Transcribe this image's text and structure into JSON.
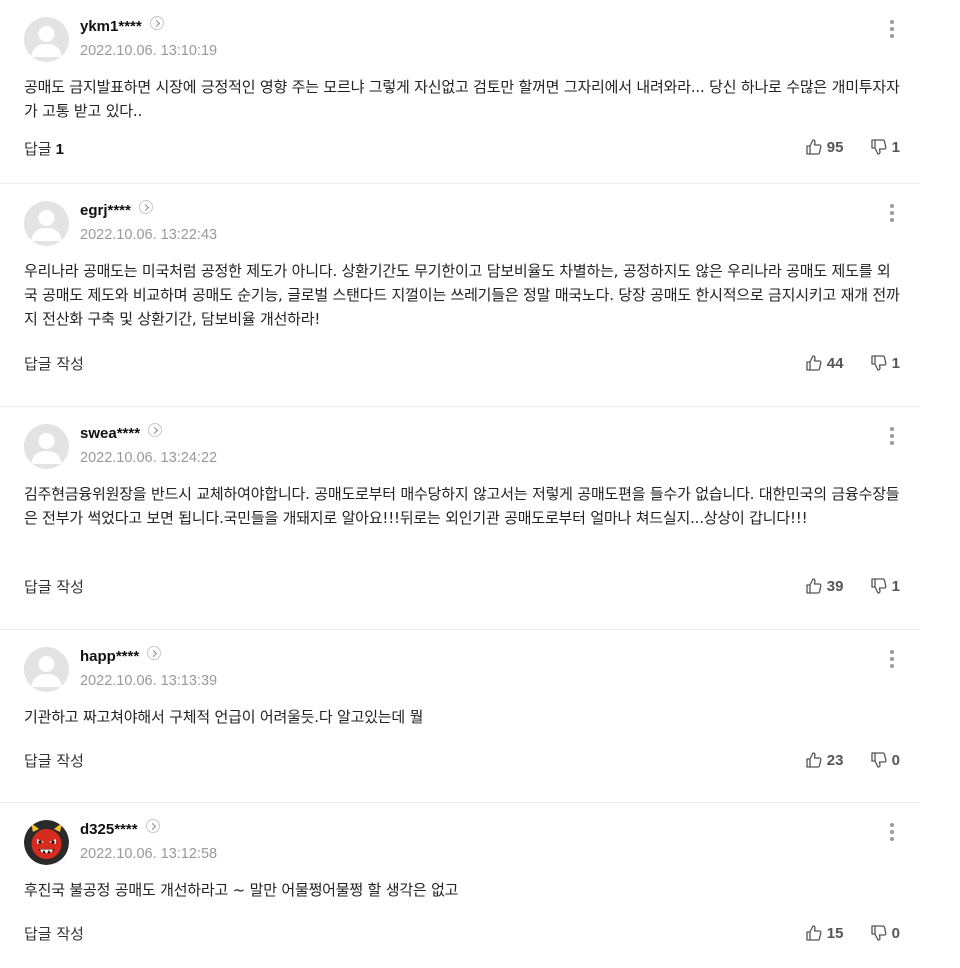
{
  "comments": [
    {
      "nickname": "ykm1****",
      "date": "2022.10.06. 13:10:19",
      "text": "공매도 금지발표하면 시장에 긍정적인 영향 주는 모르냐 그렇게 자신없고 검토만 할꺼면 그자리에서 내려와라... 당신 하나로 수많은 개미투자자가 고통 받고 있다..",
      "reply_label": "답글",
      "reply_count": "1",
      "likes": "95",
      "dislikes": "1",
      "avatar": "default-avatar"
    },
    {
      "nickname": "egrj****",
      "date": "2022.10.06. 13:22:43",
      "text": "우리나라 공매도는 미국처럼 공정한 제도가 아니다. 상환기간도 무기한이고 담보비율도 차별하는, 공정하지도 않은 우리나라 공매도 제도를 외국 공매도 제도와 비교하며 공매도 순기능, 글로벌 스탠다드 지껄이는 쓰레기들은 정말 매국노다. 당장 공매도 한시적으로 금지시키고 재개 전까지 전산화 구축 및 상환기간, 담보비율 개선하라!",
      "reply_label": "답글 작성",
      "likes": "44",
      "dislikes": "1",
      "avatar": "default-avatar"
    },
    {
      "nickname": "swea****",
      "date": "2022.10.06. 13:24:22",
      "text": "김주현금융위원장을 반드시 교체하여야합니다. 공매도로부터 매수당하지 않고서는 저렇게 공매도편을 들수가 없습니다. 대한민국의 금융수장들은 전부가 썩었다고 보면 됩니다.국민들을 개돼지로 알아요!!!뒤로는 외인기관 공매도로부터 얼마나 쳐드실지...상상이 갑니다!!!",
      "reply_label": "답글 작성",
      "likes": "39",
      "dislikes": "1",
      "avatar": "default-avatar"
    },
    {
      "nickname": "happ****",
      "date": "2022.10.06. 13:13:39",
      "text": "기관하고 짜고쳐야해서 구체적 언급이 어려울듯.다 알고있는데 뭘",
      "reply_label": "답글 작성",
      "likes": "23",
      "dislikes": "0",
      "avatar": "default-avatar"
    },
    {
      "nickname": "d325****",
      "date": "2022.10.06. 13:12:58",
      "text": "후진국 불공정 공매도 개선하라고 ~ 말만 어물쩡어물쩡 할 생각은 없고",
      "reply_label": "답글 작성",
      "likes": "15",
      "dislikes": "0",
      "avatar": "devil-avatar"
    }
  ],
  "icons": {
    "more": "kebab-menu-icon",
    "profile": "chevron-right-icon",
    "like": "thumbs-up-icon",
    "dislike": "thumbs-down-icon"
  },
  "colors": {
    "date": "#999999",
    "divider": "#eeeeee",
    "avatar_bg": "#e6e6e6",
    "devil_red": "#d62b1f"
  }
}
